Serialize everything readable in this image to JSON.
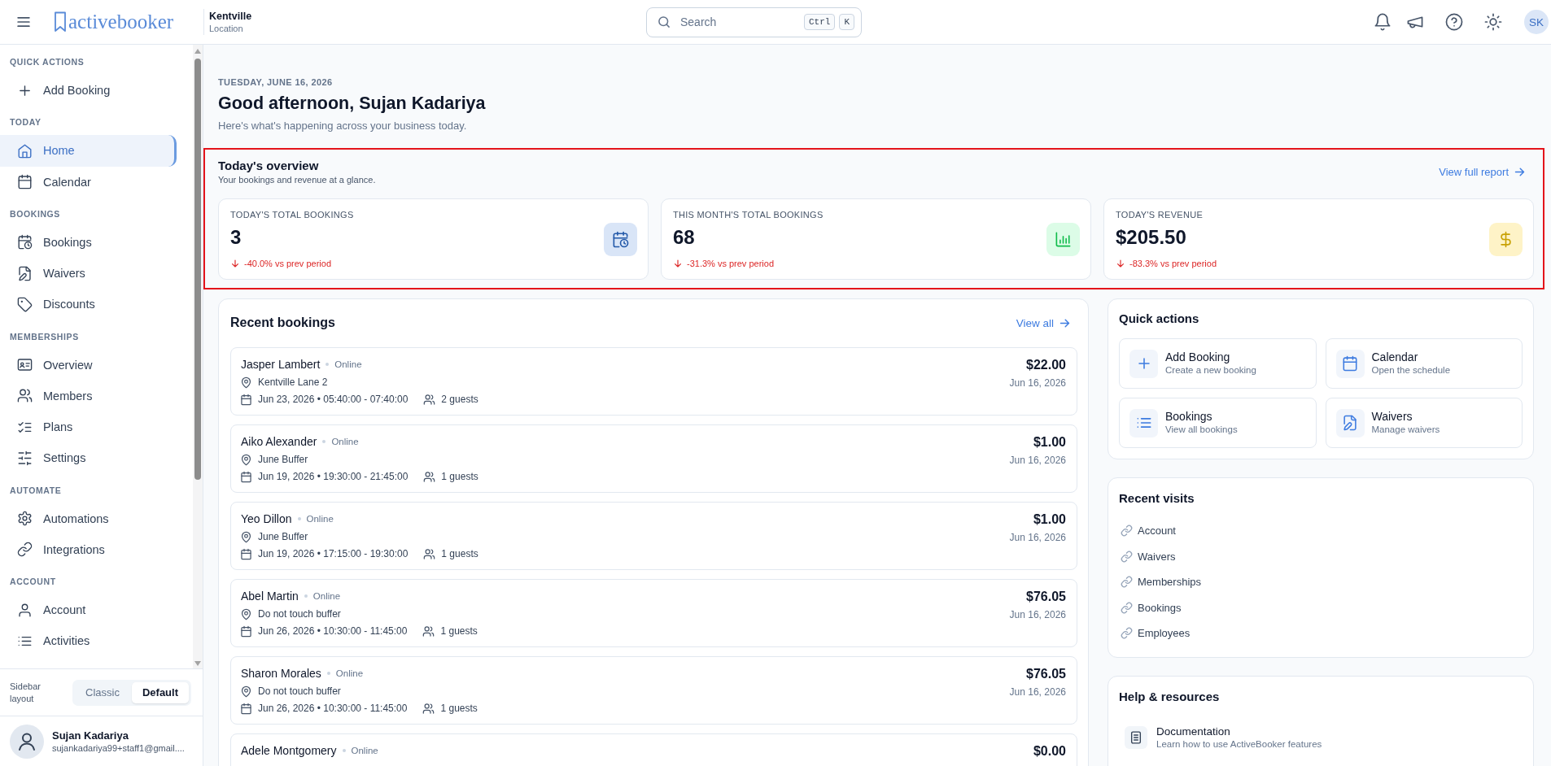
{
  "topbar": {
    "logo": "activebooker",
    "location": {
      "name": "Kentville",
      "label": "Location"
    },
    "search": {
      "placeholder": "Search",
      "keys": [
        "Ctrl",
        "K"
      ]
    },
    "avatar": "SK"
  },
  "sidebar": {
    "sections": [
      {
        "title": "QUICK ACTIONS",
        "items": [
          {
            "label": "Add Booking",
            "selected": false
          }
        ]
      },
      {
        "title": "TODAY",
        "items": [
          {
            "label": "Home",
            "selected": true
          },
          {
            "label": "Calendar",
            "selected": false
          }
        ]
      },
      {
        "title": "BOOKINGS",
        "items": [
          {
            "label": "Bookings",
            "selected": false
          },
          {
            "label": "Waivers",
            "selected": false
          },
          {
            "label": "Discounts",
            "selected": false
          }
        ]
      },
      {
        "title": "MEMBERSHIPS",
        "items": [
          {
            "label": "Overview",
            "selected": false
          },
          {
            "label": "Members",
            "selected": false
          },
          {
            "label": "Plans",
            "selected": false
          },
          {
            "label": "Settings",
            "selected": false
          }
        ]
      },
      {
        "title": "AUTOMATE",
        "items": [
          {
            "label": "Automations",
            "selected": false
          },
          {
            "label": "Integrations",
            "selected": false
          }
        ]
      },
      {
        "title": "ACCOUNT",
        "items": [
          {
            "label": "Account",
            "selected": false
          },
          {
            "label": "Activities",
            "selected": false
          }
        ]
      }
    ]
  },
  "sidebar_layout": {
    "label": "Sidebar layout",
    "options": [
      {
        "label": "Classic",
        "selected": false
      },
      {
        "label": "Default",
        "selected": true
      }
    ]
  },
  "user": {
    "name": "Sujan Kadariya",
    "email": "sujankadariya99+staff1@gmail...."
  },
  "header": {
    "date": "TUESDAY, JUNE 16, 2026",
    "greeting": "Good afternoon, Sujan Kadariya",
    "subtitle": "Here's what's happening across your business today."
  },
  "overview": {
    "title": "Today's overview",
    "subtitle": "Your bookings and revenue at a glance.",
    "link": "View full report",
    "stats": [
      {
        "label": "TODAY'S TOTAL BOOKINGS",
        "value": "3",
        "change": "-40.0% vs prev period",
        "trend_down": true,
        "color": "#d9e5f7"
      },
      {
        "label": "THIS MONTH'S TOTAL BOOKINGS",
        "value": "68",
        "change": "-31.3% vs prev period",
        "trend_down": true,
        "color": "#dcfce7"
      },
      {
        "label": "TODAY'S REVENUE",
        "value": "$205.50",
        "change": "-83.3% vs prev period",
        "trend_down": true,
        "color": "#fef3c7"
      }
    ]
  },
  "recent_bookings": {
    "title": "Recent bookings",
    "link": "View all",
    "bookings": [
      {
        "name": "Jasper Lambert",
        "channel": "Online",
        "location": "Kentville Lane 2",
        "when": "Jun 23, 2026 • 05:40:00 - 07:40:00",
        "guests": "2 guests",
        "amount": "$22.00",
        "date": "Jun 16, 2026"
      },
      {
        "name": "Aiko Alexander",
        "channel": "Online",
        "location": "June Buffer",
        "when": "Jun 19, 2026 • 19:30:00 - 21:45:00",
        "guests": "1 guests",
        "amount": "$1.00",
        "date": "Jun 16, 2026"
      },
      {
        "name": "Yeo Dillon",
        "channel": "Online",
        "location": "June Buffer",
        "when": "Jun 19, 2026 • 17:15:00 - 19:30:00",
        "guests": "1 guests",
        "amount": "$1.00",
        "date": "Jun 16, 2026"
      },
      {
        "name": "Abel Martin",
        "channel": "Online",
        "location": "Do not touch buffer",
        "when": "Jun 26, 2026 • 10:30:00 - 11:45:00",
        "guests": "1 guests",
        "amount": "$76.05",
        "date": "Jun 16, 2026"
      },
      {
        "name": "Sharon Morales",
        "channel": "Online",
        "location": "Do not touch buffer",
        "when": "Jun 26, 2026 • 10:30:00 - 11:45:00",
        "guests": "1 guests",
        "amount": "$76.05",
        "date": "Jun 16, 2026"
      },
      {
        "name": "Adele Montgomery",
        "channel": "Online",
        "amount": "$0.00"
      }
    ]
  },
  "quick_actions": {
    "title": "Quick actions",
    "actions": [
      {
        "label": "Add Booking",
        "description": "Create a new booking"
      },
      {
        "label": "Calendar",
        "description": "Open the schedule"
      },
      {
        "label": "Bookings",
        "description": "View all bookings"
      },
      {
        "label": "Waivers",
        "description": "Manage waivers"
      }
    ]
  },
  "recent_visits": {
    "title": "Recent visits",
    "items": [
      "Account",
      "Waivers",
      "Memberships",
      "Bookings",
      "Employees"
    ]
  },
  "help": {
    "title": "Help & resources",
    "items": [
      {
        "label": "Documentation",
        "description": "Learn how to use ActiveBooker features"
      }
    ]
  }
}
